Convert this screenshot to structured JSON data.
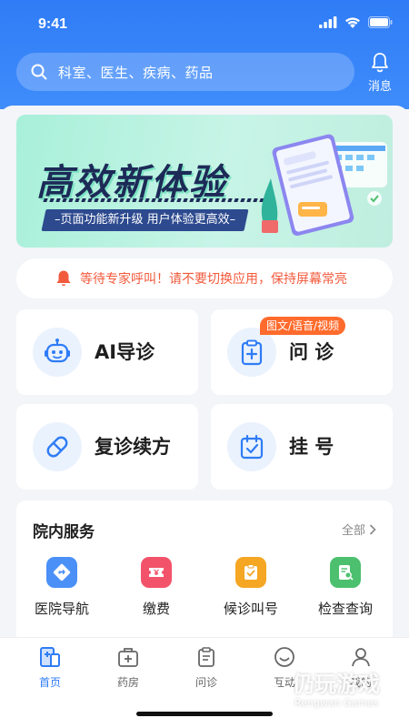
{
  "status": {
    "time": "9:41"
  },
  "header": {
    "search_placeholder": "科室、医生、疾病、药品",
    "message_label": "消息"
  },
  "banner": {
    "title": "高效新体验",
    "subtitle": "–页面功能新升级 用户体验更高效–"
  },
  "notice": {
    "text": "等待专家呼叫！请不要切换应用，保持屏幕常亮"
  },
  "cards": {
    "ai": {
      "label": "AI导诊"
    },
    "ask": {
      "label": "问  诊",
      "tag": "图文/语音/视频"
    },
    "renew": {
      "label": "复诊续方"
    },
    "register": {
      "label": "挂  号"
    }
  },
  "services": {
    "title": "院内服务",
    "more": "全部",
    "items": [
      {
        "label": "医院导航",
        "icon": "navigation-icon",
        "color": "#4a90f7"
      },
      {
        "label": "缴费",
        "icon": "payment-icon",
        "color": "#f2536b"
      },
      {
        "label": "候诊叫号",
        "icon": "queue-icon",
        "color": "#f5a623"
      },
      {
        "label": "检查查询",
        "icon": "report-search-icon",
        "color": "#4cc06e"
      }
    ]
  },
  "tabbar": {
    "items": [
      {
        "label": "首页",
        "active": true
      },
      {
        "label": "药房"
      },
      {
        "label": "问诊"
      },
      {
        "label": "互动"
      },
      {
        "label": "我的"
      }
    ]
  },
  "watermark": {
    "text": "仍玩游戏",
    "sub": "Rengwan Games"
  },
  "colors": {
    "primary": "#2f7cf6",
    "alert": "#f25a3c",
    "tag": "#ff6b2c"
  }
}
